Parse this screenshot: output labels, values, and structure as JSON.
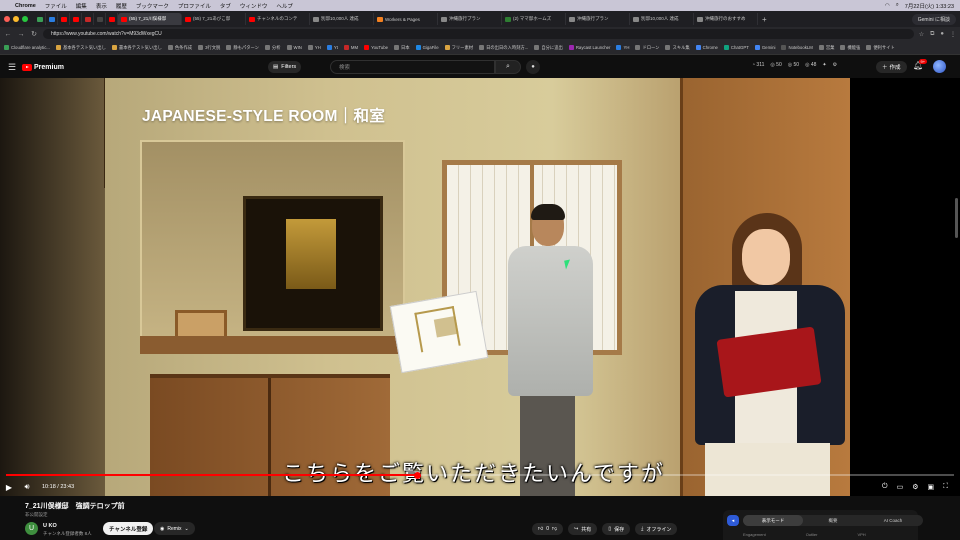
{
  "menubar": {
    "app": "Chrome",
    "items": [
      "ファイル",
      "編集",
      "表示",
      "履歴",
      "ブックマーク",
      "プロファイル",
      "タブ",
      "ウィンドウ",
      "ヘルプ"
    ],
    "right": "7月22日(火) 1:33:23"
  },
  "tabs": [
    {
      "label": "(55) 7_21川俣様邸",
      "color": "#ff0000",
      "active": true
    },
    {
      "label": "(55) 7_21あびこ邸",
      "color": "#ff0000"
    },
    {
      "label": "チャンネルのコンテ",
      "color": "#ff0000"
    },
    {
      "label": "別邸10,000人 達成",
      "color": "#888888"
    },
    {
      "label": "Workers & Pages",
      "color": "#f48120"
    },
    {
      "label": "沖縄旅行プラン",
      "color": "#888888"
    },
    {
      "label": "(2) ママ邸ホームズ",
      "color": "#2e7d32"
    },
    {
      "label": "沖縄旅行プラン",
      "color": "#888888"
    },
    {
      "label": "別邸10,000人 達成",
      "color": "#888888"
    },
    {
      "label": "沖縄旅行のおすすめ",
      "color": "#888888"
    }
  ],
  "gemini_button": "Gemini に相談",
  "address": {
    "url": "https://www.youtube.com/watch?v=M93dWxegCU"
  },
  "bookmarks": [
    "Cloudflare analytic...",
    "基本各テスト気い出し",
    "書本各テスト気い出し",
    "色条作成",
    "3行文脱",
    "静もパターン",
    "分析",
    "WIN",
    "YH",
    "Yt",
    "MM",
    "YouTube",
    "日本",
    "GigaFile",
    "フリー素材",
    "日の出日の入時刻方...",
    "自分に追出",
    "Raycast Launcher",
    "YH",
    "ドローン",
    "スキル集",
    "Chrome",
    "ChatGPT",
    "Gemini",
    "NotebookLM",
    "営業",
    "機能強",
    "便利サイト"
  ],
  "youtube": {
    "logo_label": "Premium",
    "filters_label": "Filters",
    "search_placeholder": "検索",
    "stats": [
      "311",
      "50",
      "50",
      "48"
    ],
    "create_label": "作成",
    "notif_count": "9+"
  },
  "video": {
    "overlay_title": "JAPANESE-STYLE ROOM｜和室",
    "subtitle": "こちらをご覧いただきたいんですが",
    "current_time": "10:18",
    "duration": "23:43",
    "progress_fraction": 0.434
  },
  "below": {
    "title": "7_21川俣様邸　強調テロップ前",
    "subline": "非公開設定",
    "channel_initial": "U",
    "channel_name": "U KO",
    "channel_subs": "チャンネル登録者数 8人",
    "subscribe_label": "チャンネル登録",
    "remix_label": "Remix",
    "like_count": "0",
    "share_label": "共有",
    "save_label": "保存",
    "offline_label": "オフライン"
  },
  "side_panel": {
    "modes": [
      "表示モード",
      "概要",
      "AI Coach"
    ],
    "labels": [
      "Engagement",
      "Outlier",
      "VPH"
    ]
  }
}
